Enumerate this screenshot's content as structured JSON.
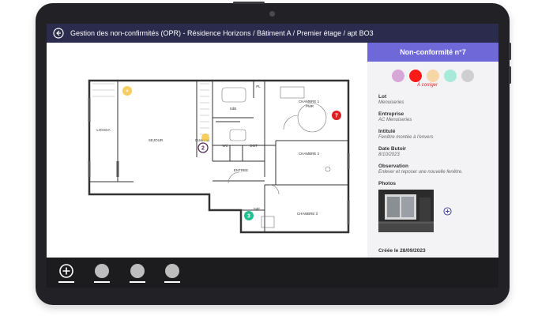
{
  "window": {
    "breadcrumb": "Gestion des non-confirmités (OPR) - Résidence Horizons / Bâtiment A / Premier étage / apt BO3"
  },
  "plan": {
    "rooms": {
      "loggia": "LOGGIA",
      "sejour": "SEJOUR",
      "cuisine": "CUISINE",
      "sdb1": "SdB",
      "wc": "WC",
      "dgt": "DGT",
      "entree": "ENTREE",
      "chambre1": "CHAMBRE 1",
      "pmr": "PMR",
      "chambre2": "CHAMBRE 2",
      "chambre3": "CHAMBRE 3",
      "sdb2": "SdE",
      "pl": "PL"
    },
    "markers": [
      {
        "label": "2",
        "color": "#ffffff",
        "border": "#5a2a5a"
      },
      {
        "label": "3",
        "color": "#1fbf8f",
        "border": "#1fbf8f"
      },
      {
        "label": "7",
        "color": "#e02020",
        "border": "#e02020"
      }
    ]
  },
  "panel": {
    "title": "Non-conformité n°7",
    "status_colors": [
      "#d9a6d9",
      "#ff1a1a",
      "#f7d7a8",
      "#a8ead9",
      "#cfcfcf"
    ],
    "status_label": "À corriger",
    "lot_label": "Lot",
    "lot_value": "Menuiseries",
    "entreprise_label": "Entreprise",
    "entreprise_value": "AC Menuiseries",
    "intitule_label": "Intitulé",
    "intitule_value": "Fenêtre montée à l'envers",
    "date_label": "Date Butoir",
    "date_value": "8/10/2023",
    "observation_label": "Observation",
    "observation_value": "Enlever et reposer une nouvelle fenêtre.",
    "photos_label": "Photos",
    "created": "Créée le 28/09/2023"
  },
  "toolbar": {
    "add_icon": "plus-circle-icon",
    "tools": [
      "tool-1",
      "tool-2",
      "tool-3"
    ]
  }
}
